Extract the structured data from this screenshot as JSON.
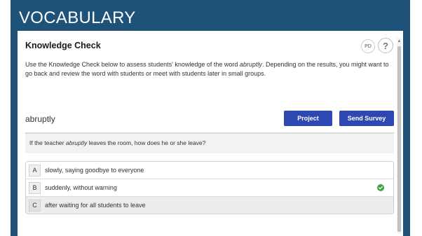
{
  "header": {
    "title": "VOCABULARY"
  },
  "panel": {
    "title": "Knowledge Check",
    "pd_label": "PD",
    "help_label": "?",
    "intro": {
      "part1": "Use the Knowledge Check below to assess students' knowledge of the word ",
      "word": "abruptly",
      "part2": ". Depending on the results, you might want to go back and review the word with students or meet with students later in small groups."
    }
  },
  "check": {
    "word": "abruptly",
    "project_label": "Project",
    "survey_label": "Send Survey",
    "question": {
      "part1": "If the teacher ",
      "word": "abruptly",
      "part2": " leaves the room, how does he or she leave?"
    },
    "answers": [
      {
        "letter": "A",
        "text": "slowly, saying goodbye to everyone",
        "correct": false
      },
      {
        "letter": "B",
        "text": "suddenly, without warning",
        "correct": true
      },
      {
        "letter": "C",
        "text": "after waiting for all students to leave",
        "correct": false
      }
    ]
  },
  "colors": {
    "header_bg": "#1f5278",
    "button_bg": "#2d48b0",
    "correct_green": "#3aa53e"
  },
  "icons": {
    "correct": "check-circle-icon",
    "help": "help-icon",
    "pd": "pd-icon"
  }
}
